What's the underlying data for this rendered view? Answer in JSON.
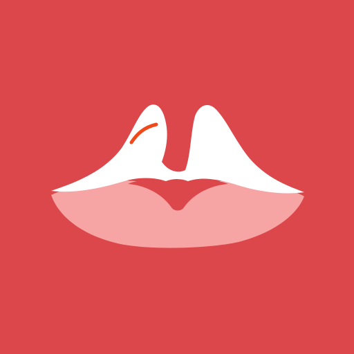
{
  "app_icon": {
    "icon_name": "lips-logo-icon",
    "colors": {
      "background": "#DC474B",
      "upper_lip": "#FFFFFF",
      "lower_lip": "#F6A4A4",
      "inner_mouth": "#DC474B",
      "accent_stroke": "#F04A1C"
    }
  }
}
